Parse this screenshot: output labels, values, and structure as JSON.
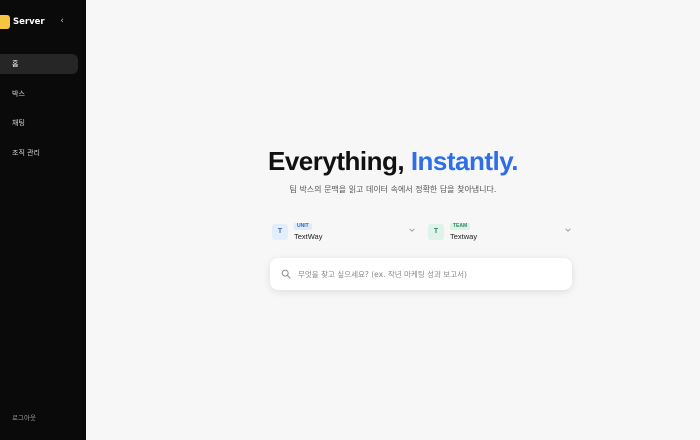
{
  "sidebar": {
    "brand_name": "Server",
    "collapse_glyph": "‹",
    "items": [
      {
        "label": "홈",
        "active": true
      },
      {
        "label": "박스",
        "active": false
      },
      {
        "label": "채팅",
        "active": false
      },
      {
        "label": "조직 관리",
        "active": false
      }
    ],
    "logout_label": "로그아웃"
  },
  "hero": {
    "title_main": "Everything,",
    "title_accent": "Instantly.",
    "subtitle": "팀 박스의 문맥을 읽고 데이터 속에서 정확한 답을 찾아냅니다."
  },
  "selectors": {
    "unit": {
      "icon_letter": "T",
      "badge": "UNIT",
      "name": "TextWay"
    },
    "team": {
      "icon_letter": "T",
      "badge": "TEAM",
      "name": "Textway"
    }
  },
  "search": {
    "placeholder": "무엇을 찾고 싶으세요? (ex. 작년 마케팅 성과 보고서)"
  },
  "icons": {
    "brand": "brand-logo-icon",
    "collapse": "chevron-left-icon",
    "dropdown": "chevron-down-icon",
    "search": "search-icon"
  },
  "colors": {
    "sidebar_bg": "#0a0a0a",
    "accent": "#2e6ee6",
    "brand": "#f5c542"
  }
}
